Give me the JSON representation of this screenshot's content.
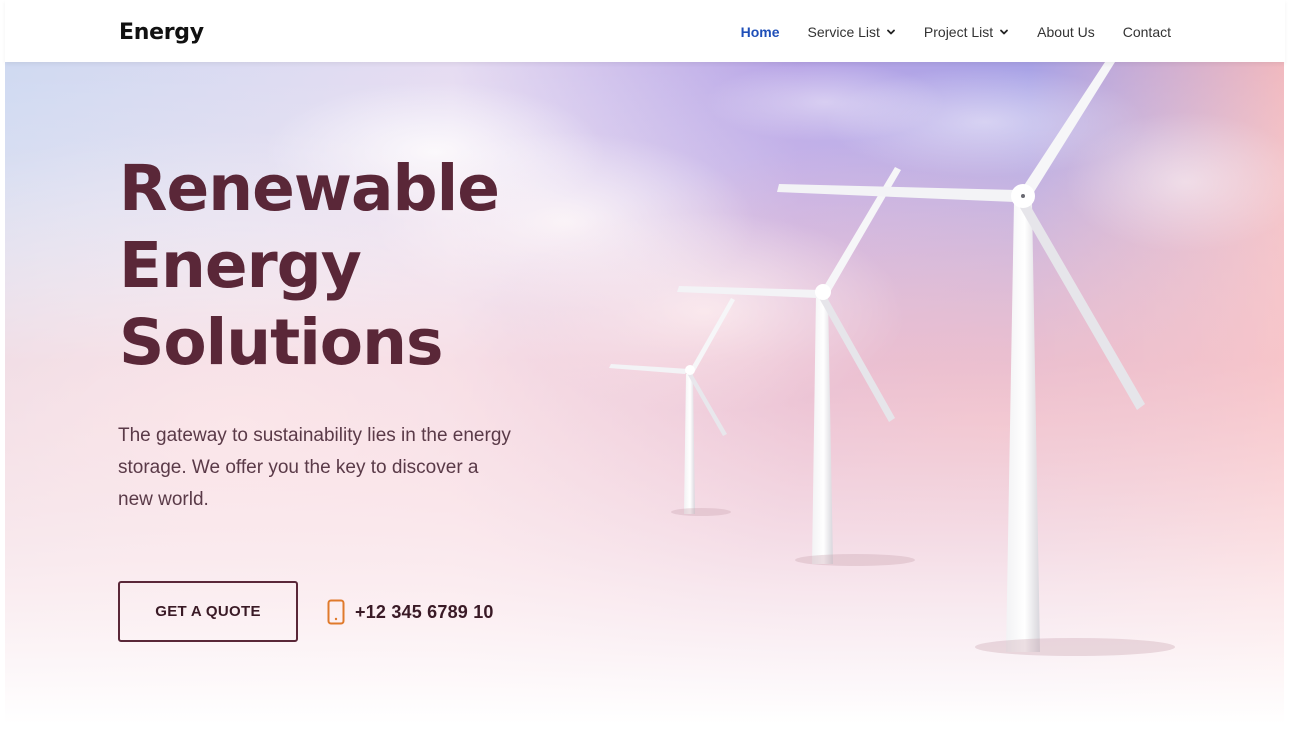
{
  "brand": {
    "logo_text": "Energy"
  },
  "nav": {
    "items": [
      {
        "label": "Home",
        "active": true,
        "has_dropdown": false
      },
      {
        "label": "Service List",
        "active": false,
        "has_dropdown": true
      },
      {
        "label": "Project List",
        "active": false,
        "has_dropdown": true
      },
      {
        "label": "About Us",
        "active": false,
        "has_dropdown": false
      },
      {
        "label": "Contact",
        "active": false,
        "has_dropdown": false
      }
    ],
    "active_color": "#1f4fb8"
  },
  "hero": {
    "headline_lines": [
      "Renewable",
      "Energy",
      "Solutions"
    ],
    "tagline": "The gateway to sustainability lies in the energy storage. We offer you the key to discover a new world.",
    "cta_label": "GET A QUOTE",
    "phone_number": "+12 345 6789 10",
    "phone_icon": "smartphone-icon",
    "background_image": "wind-turbines-illustration",
    "accent_color": "#5a2738",
    "phone_icon_color": "#e07a2c"
  }
}
